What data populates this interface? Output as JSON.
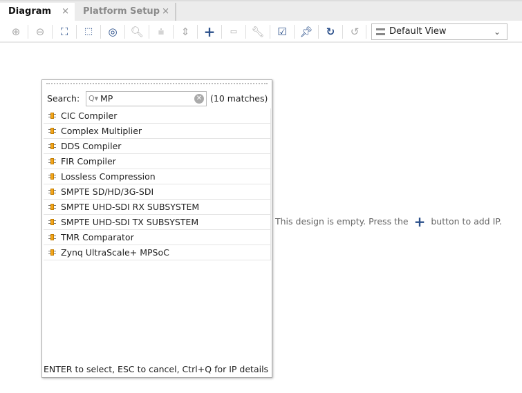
{
  "tabs": [
    {
      "label": "Diagram",
      "close": "×"
    },
    {
      "label": "Platform Setup",
      "close": "×"
    }
  ],
  "toolbar": {
    "view_select": "Default View",
    "icons": [
      "zoom-in-icon",
      "zoom-out-icon",
      "fit-view-icon",
      "select-area-icon",
      "center-icon",
      "search-icon",
      "collapse-icon",
      "expand-icon",
      "add-ip-icon",
      "add-module-icon",
      "wrench-icon",
      "validate-icon",
      "pin-icon",
      "refresh-icon",
      "regenerate-icon"
    ]
  },
  "canvas": {
    "message_before": "This design is empty. Press the",
    "message_after": "button to add IP."
  },
  "popup": {
    "search_label": "Search:",
    "search_value": "MP",
    "match_count": "(10 matches)",
    "items": [
      "CIC Compiler",
      "Complex Multiplier",
      "DDS Compiler",
      "FIR Compiler",
      "Lossless Compression",
      "SMPTE SD/HD/3G-SDI",
      "SMPTE UHD-SDI RX SUBSYSTEM",
      "SMPTE UHD-SDI TX SUBSYSTEM",
      "TMR Comparator",
      "Zynq UltraScale+ MPSoC"
    ],
    "footer": "ENTER to select, ESC to cancel, Ctrl+Q for IP details"
  }
}
